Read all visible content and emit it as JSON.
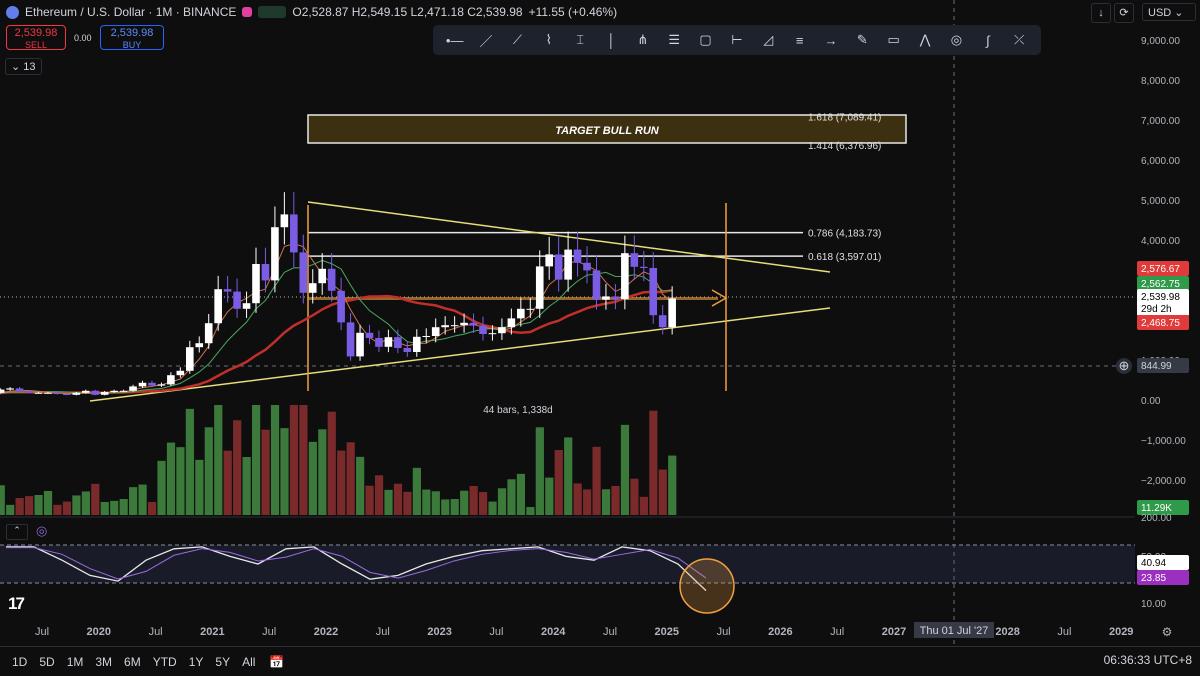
{
  "header": {
    "title": "Ethereum / U.S. Dollar · 1M · BINANCE",
    "ohlc": "O2,528.87  H2,549.15  L2,471.18  C2,539.98",
    "change": "+11.55 (+0.46%)"
  },
  "trade": {
    "sell_price": "2,539.98",
    "sell_label": "SELL",
    "spread": "0.00",
    "buy_price": "2,539.98",
    "buy_label": "BUY"
  },
  "indicators_toggle": "13",
  "currency": "USD",
  "toolbar_icons": [
    "horizontal-ray-icon",
    "trend-line-icon",
    "path-icon",
    "polyline-icon",
    "cross-line-icon",
    "vertical-line-icon",
    "pitchfork-icon",
    "parallel-channel-icon",
    "rectangle-icon",
    "fib-range-icon",
    "triangle-icon",
    "fib-extension-icon",
    "arrow-marker-icon",
    "brush-icon",
    "note-icon",
    "pattern-icon",
    "circle-icon",
    "curve-icon",
    "measure-icon"
  ],
  "timeframes": [
    "1D",
    "5D",
    "1M",
    "3M",
    "6M",
    "YTD",
    "1Y",
    "5Y",
    "All"
  ],
  "clock": "06:36:33 UTC+8",
  "crosshair_date": "Thu 01 Jul '27",
  "colors": {
    "bull": "#ffffff",
    "bear": "#7b5ce5",
    "vol_up": "#3b7a3b",
    "vol_down": "#7a2a2a",
    "accent": "#f0a040"
  },
  "chart_data": {
    "type": "candlestick",
    "ylim": [
      -2500,
      9300
    ],
    "y_ticks": [
      9000,
      8000,
      7000,
      6000,
      5000,
      4000,
      3000,
      2000,
      1000,
      0,
      -1000,
      -2000
    ],
    "y_tick_labels": [
      "9,000.00",
      "8,000.00",
      "7,000.00",
      "6,000.00",
      "5,000.00",
      "4,000.00",
      "3,000.00",
      "2,000.00",
      "1,000.00",
      "0.00",
      "−1,000.00",
      "−2,000.00"
    ],
    "x_labels": [
      "Jul",
      "2020",
      "Jul",
      "2021",
      "Jul",
      "2022",
      "Jul",
      "2023",
      "Jul",
      "2024",
      "Jul",
      "2025",
      "Jul",
      "2026",
      "Jul",
      "2027",
      "Jul",
      "2028",
      "Jul",
      "2029"
    ],
    "candles_start": "2019-01",
    "closes": [
      140,
      140,
      150,
      180,
      260,
      290,
      220,
      180,
      180,
      180,
      150,
      130,
      180,
      230,
      130,
      200,
      230,
      230,
      340,
      430,
      360,
      390,
      620,
      730,
      1320,
      1420,
      1920,
      2770,
      2710,
      2280,
      2420,
      3400,
      2990,
      4320,
      4640,
      3690,
      2680,
      2920,
      3280,
      2730,
      1940,
      1090,
      1680,
      1550,
      1330,
      1570,
      1300,
      1200,
      1580,
      1600,
      1820,
      1870,
      1870,
      1930,
      1860,
      1650,
      1670,
      1820,
      2040,
      2280,
      2280,
      3340,
      3640,
      3010,
      3760,
      3430,
      3240,
      2510,
      2590,
      2520,
      3670,
      3330,
      3300,
      2120,
      1820,
      2540
    ],
    "price_labels": {
      "last": "2,539.98",
      "countdown": "29d 2h",
      "red_top": "2,576.67",
      "green": "2,562.75",
      "red_bottom": "2,468.75",
      "crosshair": "844.99"
    },
    "fib_levels": [
      {
        "label": "1.618 (7,089.41)",
        "value": 7089.41
      },
      {
        "label": "1.414 (6,376.96)",
        "value": 6376.96
      },
      {
        "label": "0.786 (4,183.73)",
        "value": 4183.73
      },
      {
        "label": "0.618 (3,597.01)",
        "value": 3597.01
      }
    ],
    "target_box_label": "TARGET BULL RUN",
    "measure_label": "44 bars, 1,338d",
    "volume_label": "11.29K",
    "rsi": {
      "y_ticks": [
        200,
        50,
        10
      ],
      "y_tick_labels": [
        "200.00",
        "50.00",
        "10.00"
      ],
      "value_white": "40.94",
      "value_purple": "23.85"
    }
  }
}
